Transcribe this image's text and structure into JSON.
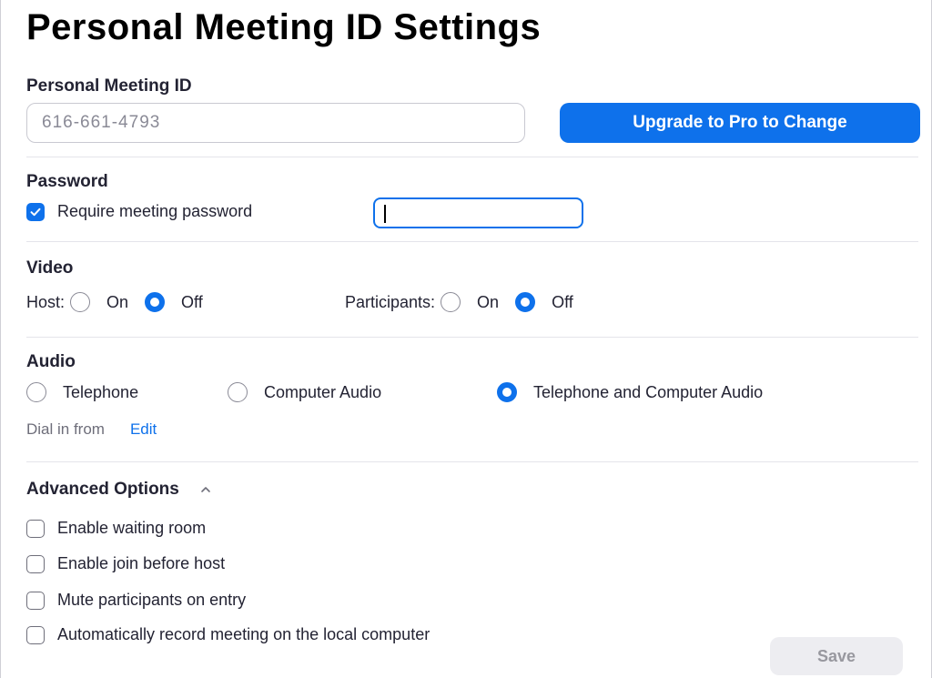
{
  "page": {
    "title": "Personal Meeting ID Settings"
  },
  "pmi": {
    "label": "Personal Meeting ID",
    "value": "616-661-4793",
    "upgrade_button": "Upgrade to Pro to Change"
  },
  "password": {
    "label": "Password",
    "require_label": "Require meeting password",
    "require_checked": true,
    "value": ""
  },
  "video": {
    "label": "Video",
    "host_label": "Host:",
    "participants_label": "Participants:",
    "on_label": "On",
    "off_label": "Off",
    "host_selected": "Off",
    "participants_selected": "Off"
  },
  "audio": {
    "label": "Audio",
    "options": [
      "Telephone",
      "Computer Audio",
      "Telephone and Computer Audio"
    ],
    "selected": "Telephone and Computer Audio",
    "dial_in_label": "Dial in from",
    "edit_link": "Edit"
  },
  "advanced": {
    "label": "Advanced Options",
    "expanded": true,
    "options": [
      {
        "label": "Enable waiting room",
        "checked": false
      },
      {
        "label": "Enable join before host",
        "checked": false
      },
      {
        "label": "Mute participants on entry",
        "checked": false
      },
      {
        "label": "Automatically record meeting on the local computer",
        "checked": false
      }
    ]
  },
  "footer": {
    "save_label": "Save",
    "save_enabled": false
  },
  "colors": {
    "accent": "#0e71eb",
    "text": "#232333",
    "muted": "#6e6e7a"
  }
}
